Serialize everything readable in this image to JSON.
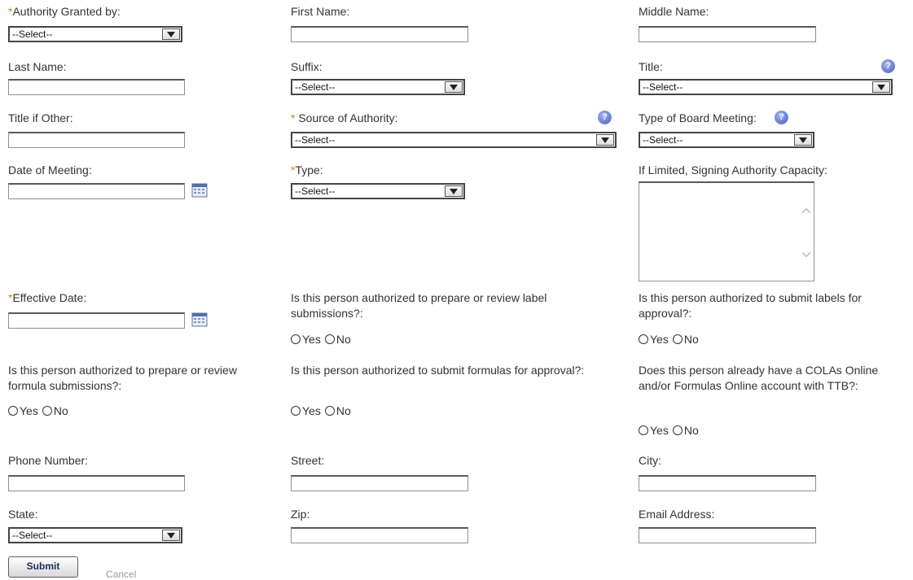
{
  "form": {
    "authority_granted_by": {
      "label": "Authority Granted by:",
      "value": "--Select--"
    },
    "first_name": {
      "label": "First Name:",
      "value": ""
    },
    "middle_name": {
      "label": "Middle Name:",
      "value": ""
    },
    "last_name": {
      "label": "Last Name:",
      "value": ""
    },
    "suffix": {
      "label": "Suffix:",
      "value": "--Select--"
    },
    "title": {
      "label": "Title:",
      "value": "--Select--"
    },
    "title_if_other": {
      "label": "Title if Other:",
      "value": ""
    },
    "source_of_authority": {
      "label": "Source of Authority:",
      "value": "--Select--"
    },
    "type_of_board_meeting": {
      "label": "Type of Board Meeting:",
      "value": "--Select--"
    },
    "date_of_meeting": {
      "label": "Date of Meeting:",
      "value": ""
    },
    "type": {
      "label": "Type:",
      "value": "--Select--"
    },
    "signing_capacity": {
      "label": "If Limited, Signing Authority Capacity:",
      "value": ""
    },
    "effective_date": {
      "label": "Effective Date:",
      "value": ""
    },
    "prepare_label": {
      "label": "Is this person authorized to prepare or review label submissions?:"
    },
    "submit_labels": {
      "label": "Is this person authorized to submit labels for approval?:"
    },
    "prepare_formula": {
      "label": "Is this person authorized to prepare or review formula submissions?:"
    },
    "submit_formulas": {
      "label": "Is this person authorized to submit formulas for approval?:"
    },
    "existing_account": {
      "label": "Does this person already have a COLAs Online and/or Formulas Online account with TTB?:"
    },
    "phone": {
      "label": "Phone Number:",
      "value": ""
    },
    "street": {
      "label": "Street:",
      "value": ""
    },
    "city": {
      "label": "City:",
      "value": ""
    },
    "state": {
      "label": "State:",
      "value": "--Select--"
    },
    "zip": {
      "label": "Zip:",
      "value": ""
    },
    "email": {
      "label": "Email Address:",
      "value": ""
    }
  },
  "common": {
    "required_marker": "*",
    "yes": "Yes",
    "no": "No",
    "help_glyph": "?"
  },
  "actions": {
    "submit": "Submit",
    "secondary": "Cancel"
  }
}
